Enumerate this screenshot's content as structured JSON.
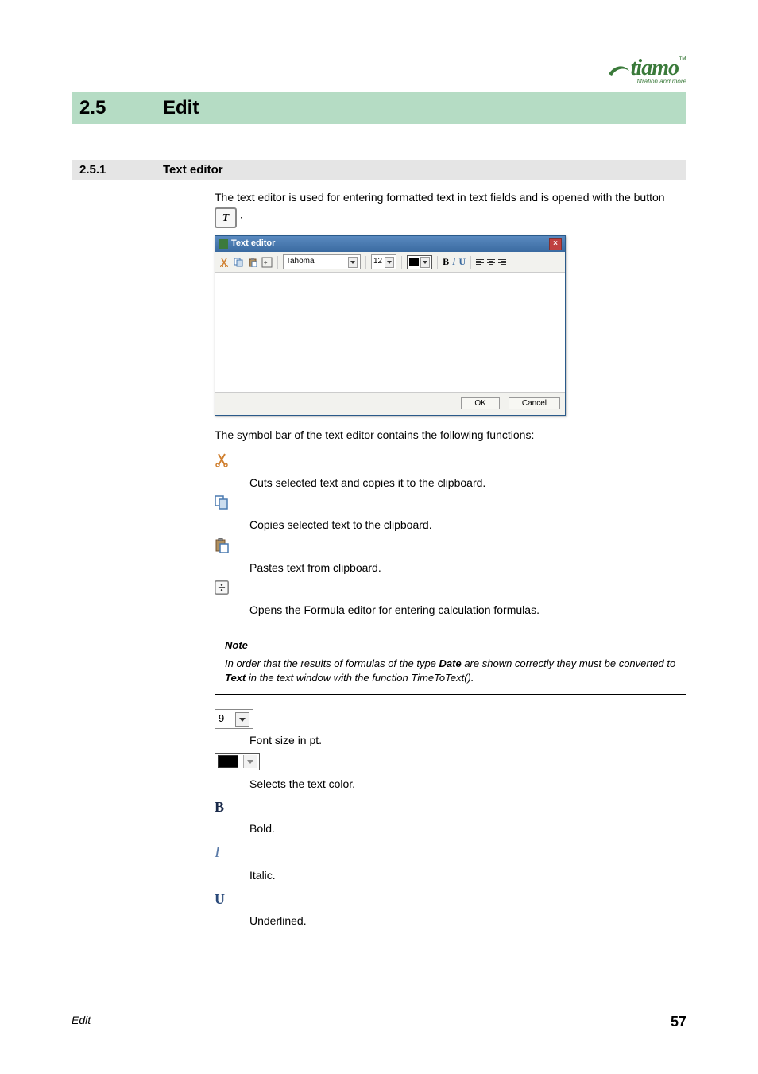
{
  "brand": {
    "name": "tiamo",
    "tm": "™",
    "tagline": "titration and more"
  },
  "section": {
    "number": "2.5",
    "title": "Edit"
  },
  "subsection": {
    "number": "2.5.1",
    "title": "Text editor"
  },
  "intro": {
    "part1": "The text editor is used for entering formatted text in text fields and is opened with the button ",
    "part2": " ."
  },
  "editor_button_glyph": "T",
  "editor_window": {
    "title": "Text editor",
    "font_name": "Tahoma",
    "font_size": "12",
    "bold": "B",
    "italic": "I",
    "underline": "U",
    "ok": "OK",
    "cancel": "Cancel"
  },
  "symbol_bar_intro": "The symbol bar of the text editor contains the following functions:",
  "symbols": {
    "cut": "Cuts selected text and copies it to the clipboard.",
    "copy": "Copies selected text to the clipboard.",
    "paste": "Pastes text from clipboard.",
    "formula": "Opens the Formula editor for entering calculation formulas."
  },
  "note": {
    "title": "Note",
    "text1": "In order that the results of formulas of the type ",
    "kw1": "Date",
    "text2": " are shown correctly they must be converted to ",
    "kw2": "Text",
    "text3": " in the text window with the function TimeToText()."
  },
  "controls": {
    "fontsize_value": "9",
    "fontsize_desc": "Font size in pt.",
    "color_desc": "Selects the text color.",
    "bold_glyph": "B",
    "bold_desc": "Bold.",
    "italic_glyph": "I",
    "italic_desc": "Italic.",
    "underline_glyph": "U",
    "underline_desc": "Underlined."
  },
  "footer": {
    "left": "Edit",
    "right": "57"
  }
}
